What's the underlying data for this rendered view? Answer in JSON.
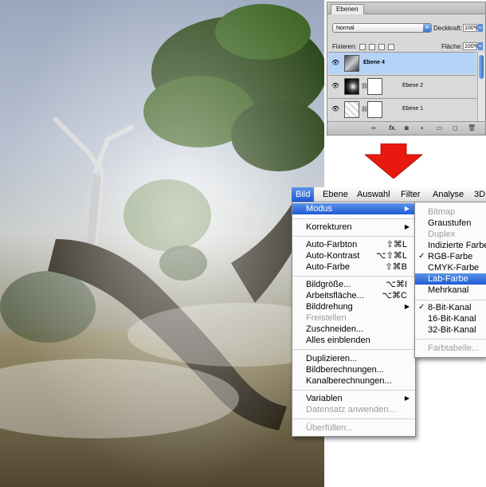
{
  "layers_panel": {
    "tab": "Ebenen",
    "blend_mode": "Normal",
    "opacity_label": "Deckkraft:",
    "opacity_value": "100%",
    "lock_label": "Fixieren:",
    "fill_label": "Fläche:",
    "fill_value": "100%",
    "layers": [
      {
        "name": "Ebene 4",
        "active": true
      },
      {
        "name": "Ebene 2",
        "active": false
      },
      {
        "name": "Ebene 1",
        "active": false
      }
    ],
    "footer_fx": "fx."
  },
  "arrow_color": "#e81a10",
  "menubar": [
    "Bild",
    "Ebene",
    "Auswahl",
    "Filter",
    "Analyse",
    "3D"
  ],
  "bild_menu": [
    {
      "label": "Modus",
      "submenu": true,
      "highlighted": true
    },
    {
      "label": "Korrekturen",
      "submenu": true
    },
    {
      "label": "Auto-Farbton",
      "shortcut": "⇧⌘L"
    },
    {
      "label": "Auto-Kontrast",
      "shortcut": "⌥⇧⌘L"
    },
    {
      "label": "Auto-Farbe",
      "shortcut": "⇧⌘B"
    },
    {
      "label": "Bildgröße...",
      "shortcut": "⌥⌘I"
    },
    {
      "label": "Arbeitsfläche...",
      "shortcut": "⌥⌘C"
    },
    {
      "label": "Bilddrehung",
      "submenu": true
    },
    {
      "label": "Freistellen",
      "disabled": true
    },
    {
      "label": "Zuschneiden..."
    },
    {
      "label": "Alles einblenden"
    },
    {
      "label": "Duplizieren..."
    },
    {
      "label": "Bildberechnungen..."
    },
    {
      "label": "Kanalberechnungen..."
    },
    {
      "label": "Variablen",
      "submenu": true
    },
    {
      "label": "Datensatz anwenden...",
      "disabled": true
    },
    {
      "label": "Überfüllen...",
      "disabled": true
    }
  ],
  "modus_menu": [
    {
      "label": "Bitmap",
      "disabled": true
    },
    {
      "label": "Graustufen"
    },
    {
      "label": "Duplex",
      "disabled": true
    },
    {
      "label": "Indizierte Farbe..."
    },
    {
      "label": "RGB-Farbe",
      "checked": true
    },
    {
      "label": "CMYK-Farbe"
    },
    {
      "label": "Lab-Farbe",
      "highlighted": true
    },
    {
      "label": "Mehrkanal"
    },
    {
      "label": "8-Bit-Kanal",
      "checked": true
    },
    {
      "label": "16-Bit-Kanal"
    },
    {
      "label": "32-Bit-Kanal"
    },
    {
      "label": "Farbtabelle...",
      "disabled": true
    }
  ],
  "check_mark": "✓"
}
